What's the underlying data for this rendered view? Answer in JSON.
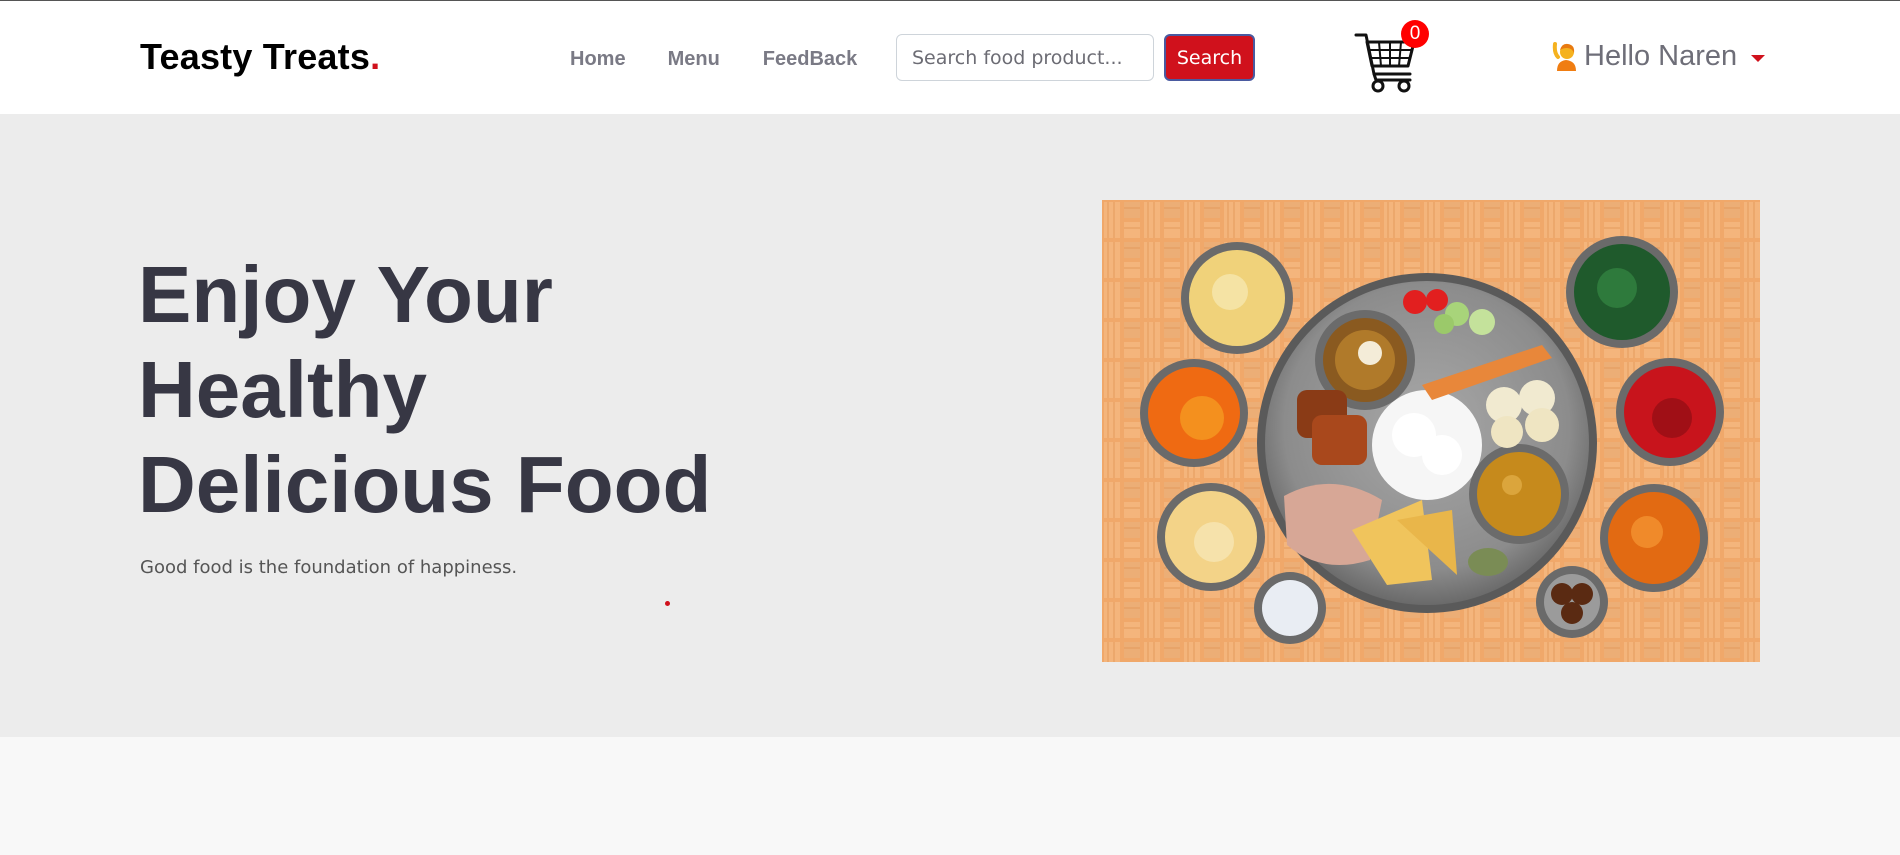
{
  "brand": {
    "name": "Teasty Treats",
    "dot": "."
  },
  "nav": {
    "links": [
      {
        "label": "Home"
      },
      {
        "label": "Menu"
      },
      {
        "label": "FeedBack"
      }
    ]
  },
  "search": {
    "placeholder": "Search food product...",
    "value": "",
    "button_label": "Search"
  },
  "cart": {
    "count": "0",
    "icon": "shopping-cart-icon"
  },
  "user": {
    "greeting": "Hello Naren",
    "icon": "person-raising-hand-emoji"
  },
  "hero": {
    "title_lines": [
      "Enjoy Your",
      "Healthy",
      "Delicious Food"
    ],
    "subtitle": "Good food is the foundation of happiness.",
    "image": "thali-platter-illustration"
  },
  "colors": {
    "accent": "#d0111c",
    "hero_bg": "#ececec",
    "title": "#373744",
    "nav_text": "#7a7a85",
    "tray_bg": "#f0a86a"
  }
}
